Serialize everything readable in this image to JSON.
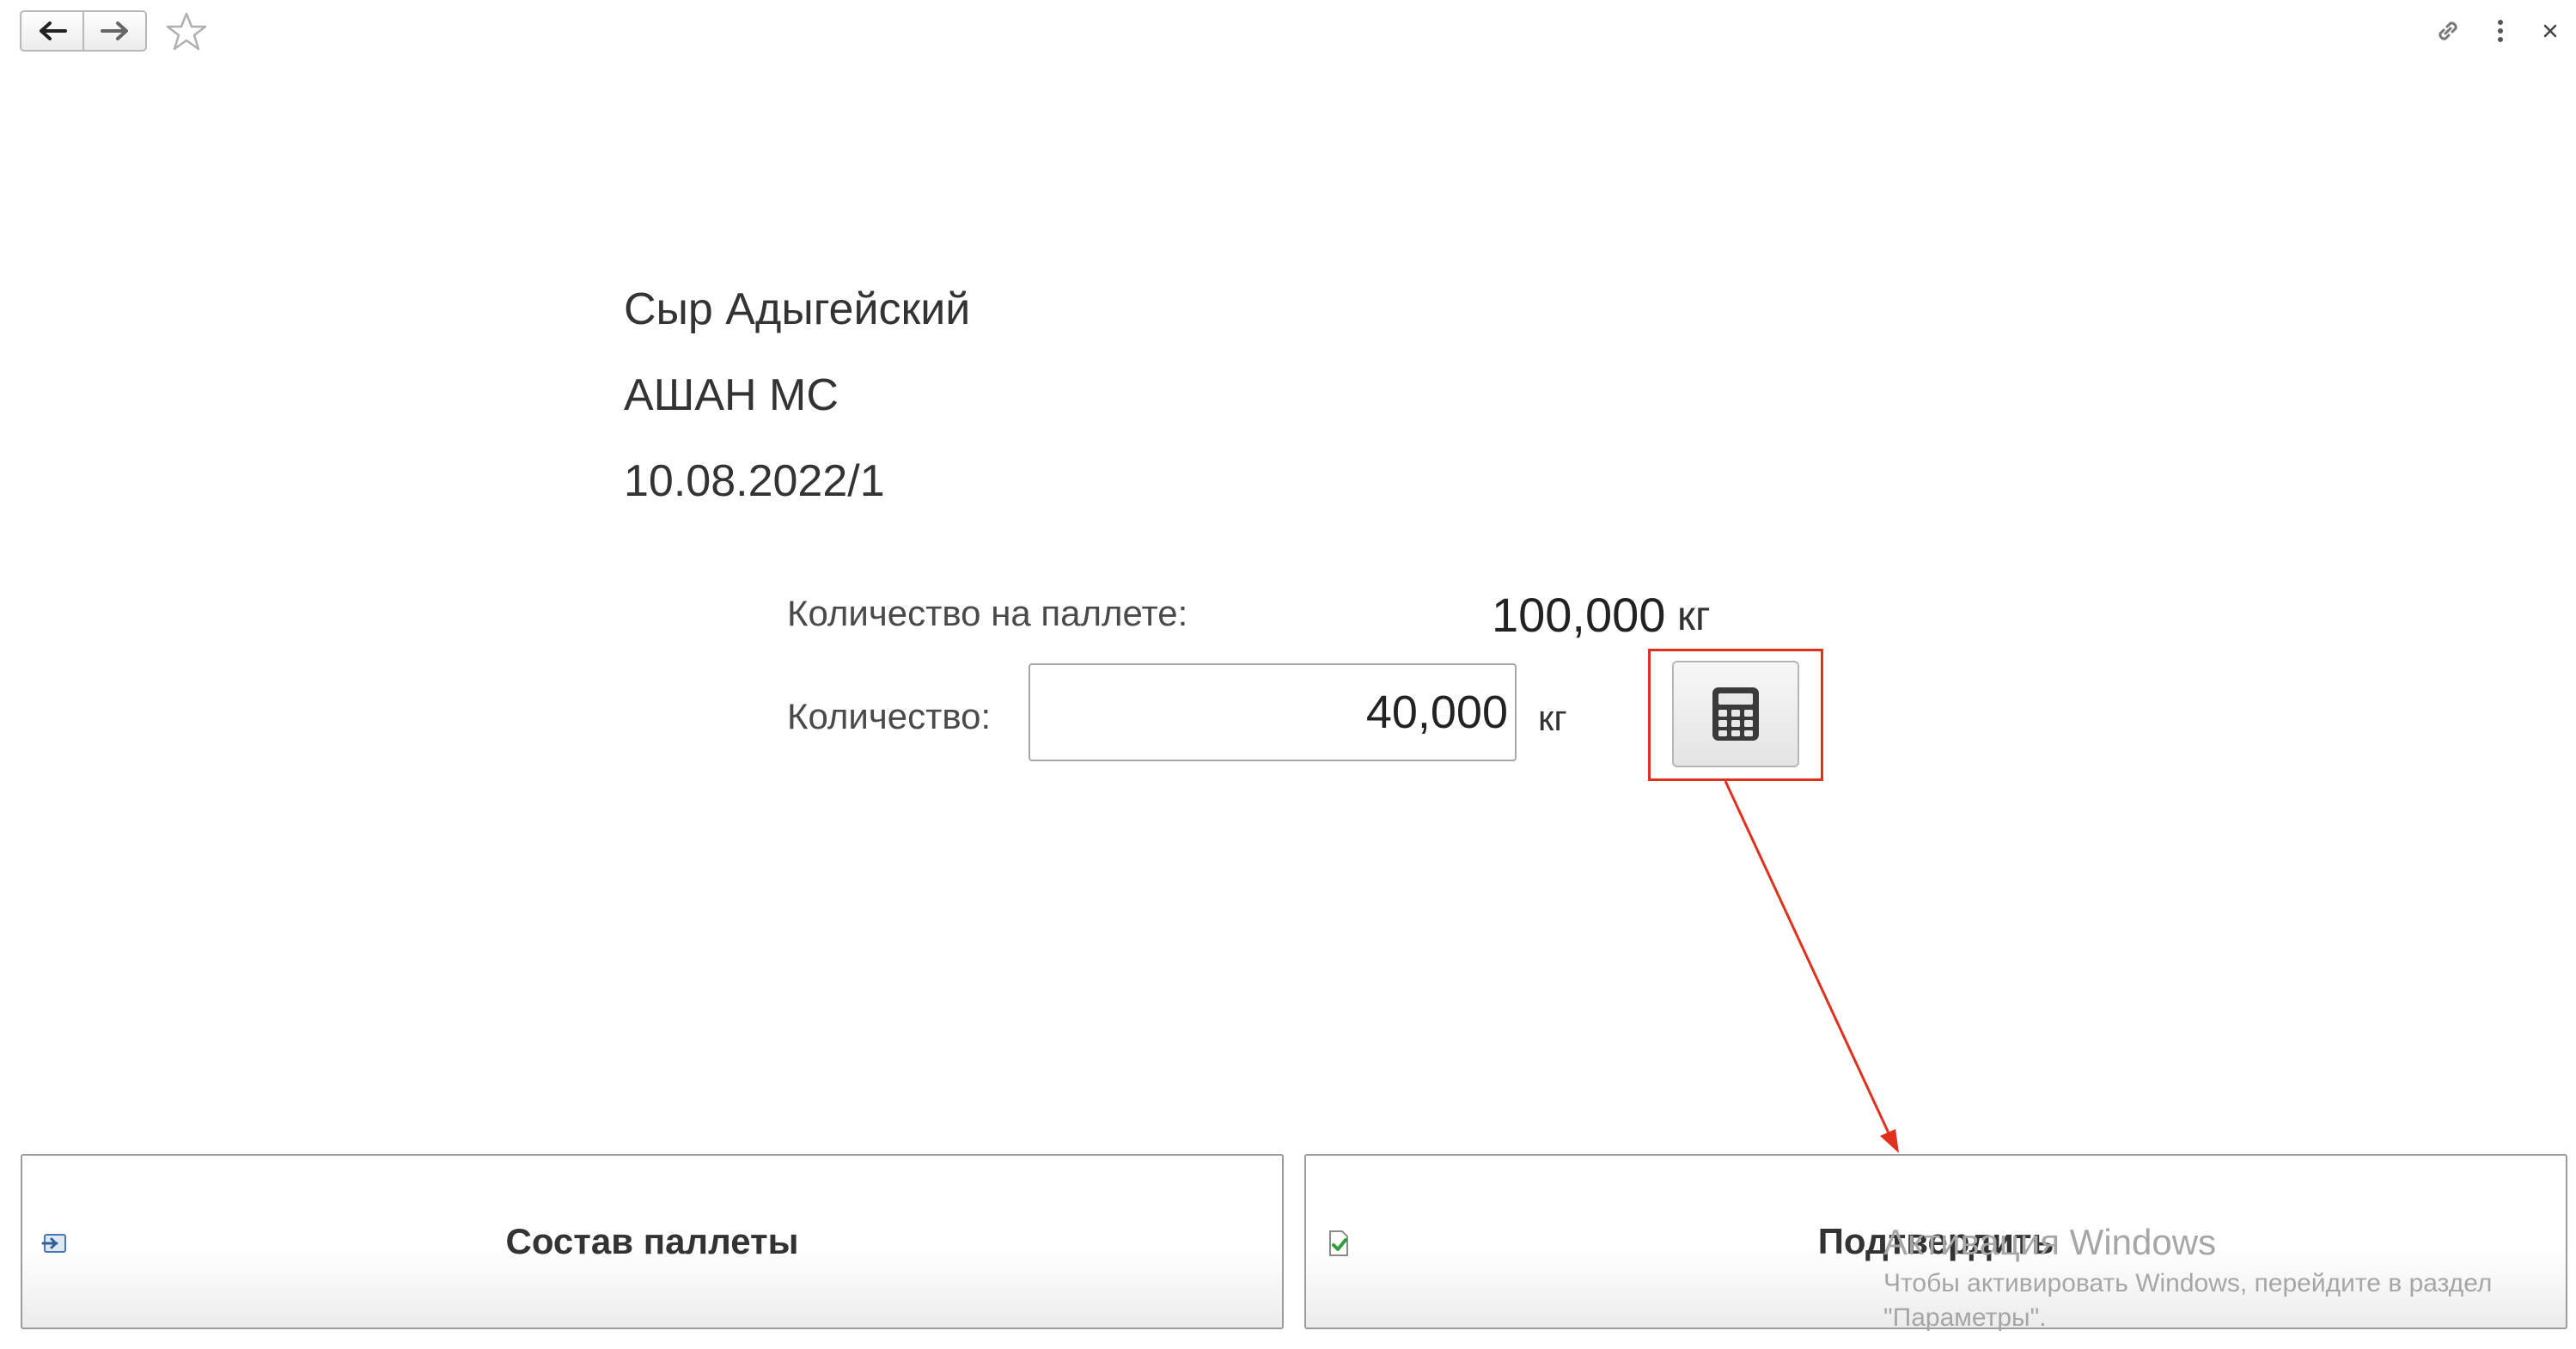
{
  "toolbar": {
    "back_icon": "arrow-left-icon",
    "forward_icon": "arrow-right-icon",
    "favorite_icon": "star-icon",
    "link_icon": "link-icon",
    "more_icon": "more-vertical-icon",
    "close_icon": "close-icon"
  },
  "info": {
    "product": "Сыр Адыгейский",
    "client": "АШАН МС",
    "document": "10.08.2022/1"
  },
  "pallet": {
    "label": "Количество на паллете:",
    "value": "100,000",
    "unit": "кг"
  },
  "quantity": {
    "label": "Количество:",
    "value": "40,000",
    "unit": "кг",
    "calculator_icon": "calculator-icon"
  },
  "annotation": {
    "color": "#e0301e"
  },
  "buttons": {
    "pallet_contents": "Состав паллеты",
    "confirm": "Подтвердить"
  },
  "watermark": {
    "title": "Активация Windows",
    "subtitle": "Чтобы активировать Windows, перейдите в раздел \"Параметры\"."
  }
}
